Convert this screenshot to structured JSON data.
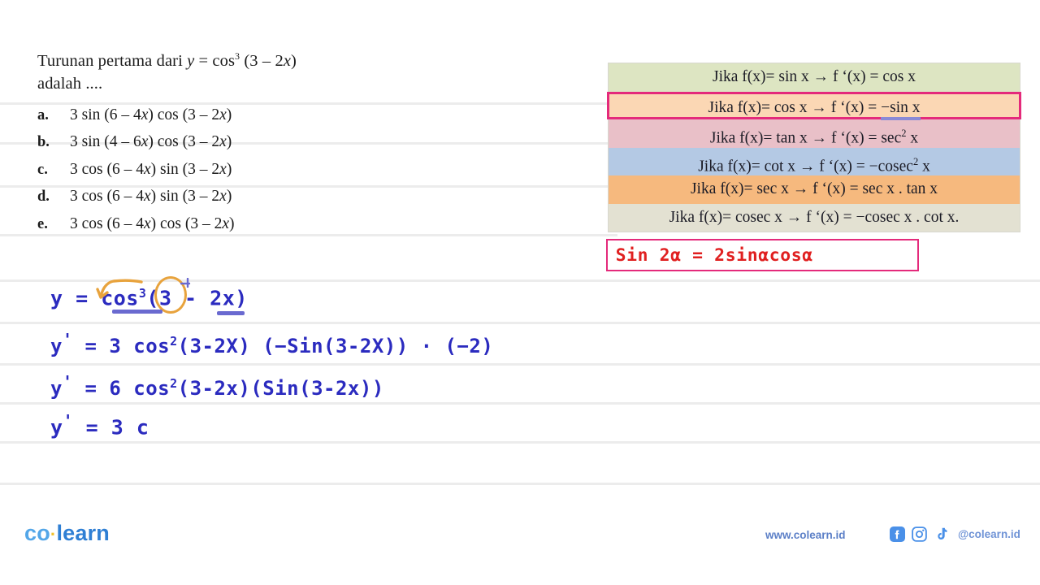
{
  "question": {
    "stem_line1_pre": "Turunan pertama dari ",
    "stem_var_y": "y",
    "stem_eq": " = cos",
    "stem_sup": "3",
    "stem_arg_pre": " (3 ",
    "stem_minus": "– 2",
    "stem_var_x": "x",
    "stem_arg_post": ")",
    "stem_line2": "adalah ....",
    "options": [
      {
        "label": "a.",
        "pre": "3 sin (6 ",
        "mid": "– 4",
        "v1": "x",
        "mid2": ") cos (3 ",
        "mid3": "– 2",
        "v2": "x",
        "post": ")"
      },
      {
        "label": "b.",
        "pre": "3 sin (4 ",
        "mid": "– 6",
        "v1": "x",
        "mid2": ") cos (3 ",
        "mid3": "– 2",
        "v2": "x",
        "post": ")"
      },
      {
        "label": "c.",
        "pre": "3 cos (6 ",
        "mid": "– 4",
        "v1": "x",
        "mid2": ") sin (3 ",
        "mid3": "– 2",
        "v2": "x",
        "post": ")"
      },
      {
        "label": "d.",
        "pre": "3 cos (6 ",
        "mid": "– 4",
        "v1": "x",
        "mid2": ") sin (3 ",
        "mid3": "– 2",
        "v2": "x",
        "post": ")"
      },
      {
        "label": "e.",
        "pre": "3 cos (6 ",
        "mid": "– 4",
        "v1": "x",
        "mid2": ") cos (3 ",
        "mid3": "– 2",
        "v2": "x",
        "post": ")"
      }
    ]
  },
  "derivative_table": {
    "rows": [
      {
        "text_before": "Jika f(x)= sin x → f ‘(x) = cos x",
        "underlined": "",
        "text_after": "",
        "bg": "#dde5c2",
        "highlighted": false
      },
      {
        "text_before": "Jika f(x)= cos x → f ‘(x) = ",
        "underlined": "−sin x",
        "text_after": "",
        "bg": "#fbd7b4",
        "highlighted": true
      },
      {
        "text_before": "Jika f(x)= tan x → f ‘(x) = sec",
        "sup": "2",
        "text_after": " x",
        "underlined": "",
        "bg": "#e9c0c8",
        "highlighted": false
      },
      {
        "text_before": "Jika f(x)= cot x → f ‘(x) = −cosec",
        "sup": "2",
        "text_after": " x",
        "underlined": "",
        "bg": "#b4c9e4",
        "highlighted": false
      },
      {
        "text_before": "Jika f(x)= sec x → f ‘(x) = sec x . tan x",
        "underlined": "",
        "text_after": "",
        "bg": "#f6b97e",
        "highlighted": false
      },
      {
        "text_before": "Jika f(x)= cosec x → f ‘(x) = −cosec x . cot x.",
        "underlined": "",
        "text_after": "",
        "bg": "#e3e1d2",
        "highlighted": false
      }
    ],
    "highlight_border_color": "#e42a7b",
    "underline_color": "#8a8ad6"
  },
  "identity_box": {
    "text": "Sin 2α = 2sinαcosα",
    "border_color": "#e42a7b",
    "text_color": "#e02020"
  },
  "handwritten_work": {
    "ink_color": "#2b2bbf",
    "annotation_color": "#e8a33d",
    "line1_pre": "y = cos",
    "line1_sup": "3",
    "line1_post": "(3 - 2x)",
    "line2_pre": "y",
    "line2_prime": "'",
    "line2_a": " = 3 cos",
    "line2_sup": "2",
    "line2_b": "(3-2X) (−Sin(3-2X)) · (−2)",
    "line3_pre": "y",
    "line3_prime": "'",
    "line3_a": " = 6 cos",
    "line3_sup": "2",
    "line3_b": "(3-2x)(Sin(3-2x))",
    "line4_pre": "y",
    "line4_prime": "'",
    "line4_a": " = 3 c"
  },
  "footer": {
    "logo_co": "co",
    "logo_dot": "·",
    "logo_learn": "learn",
    "url": "www.colearn.id",
    "handle": "@colearn.id"
  }
}
